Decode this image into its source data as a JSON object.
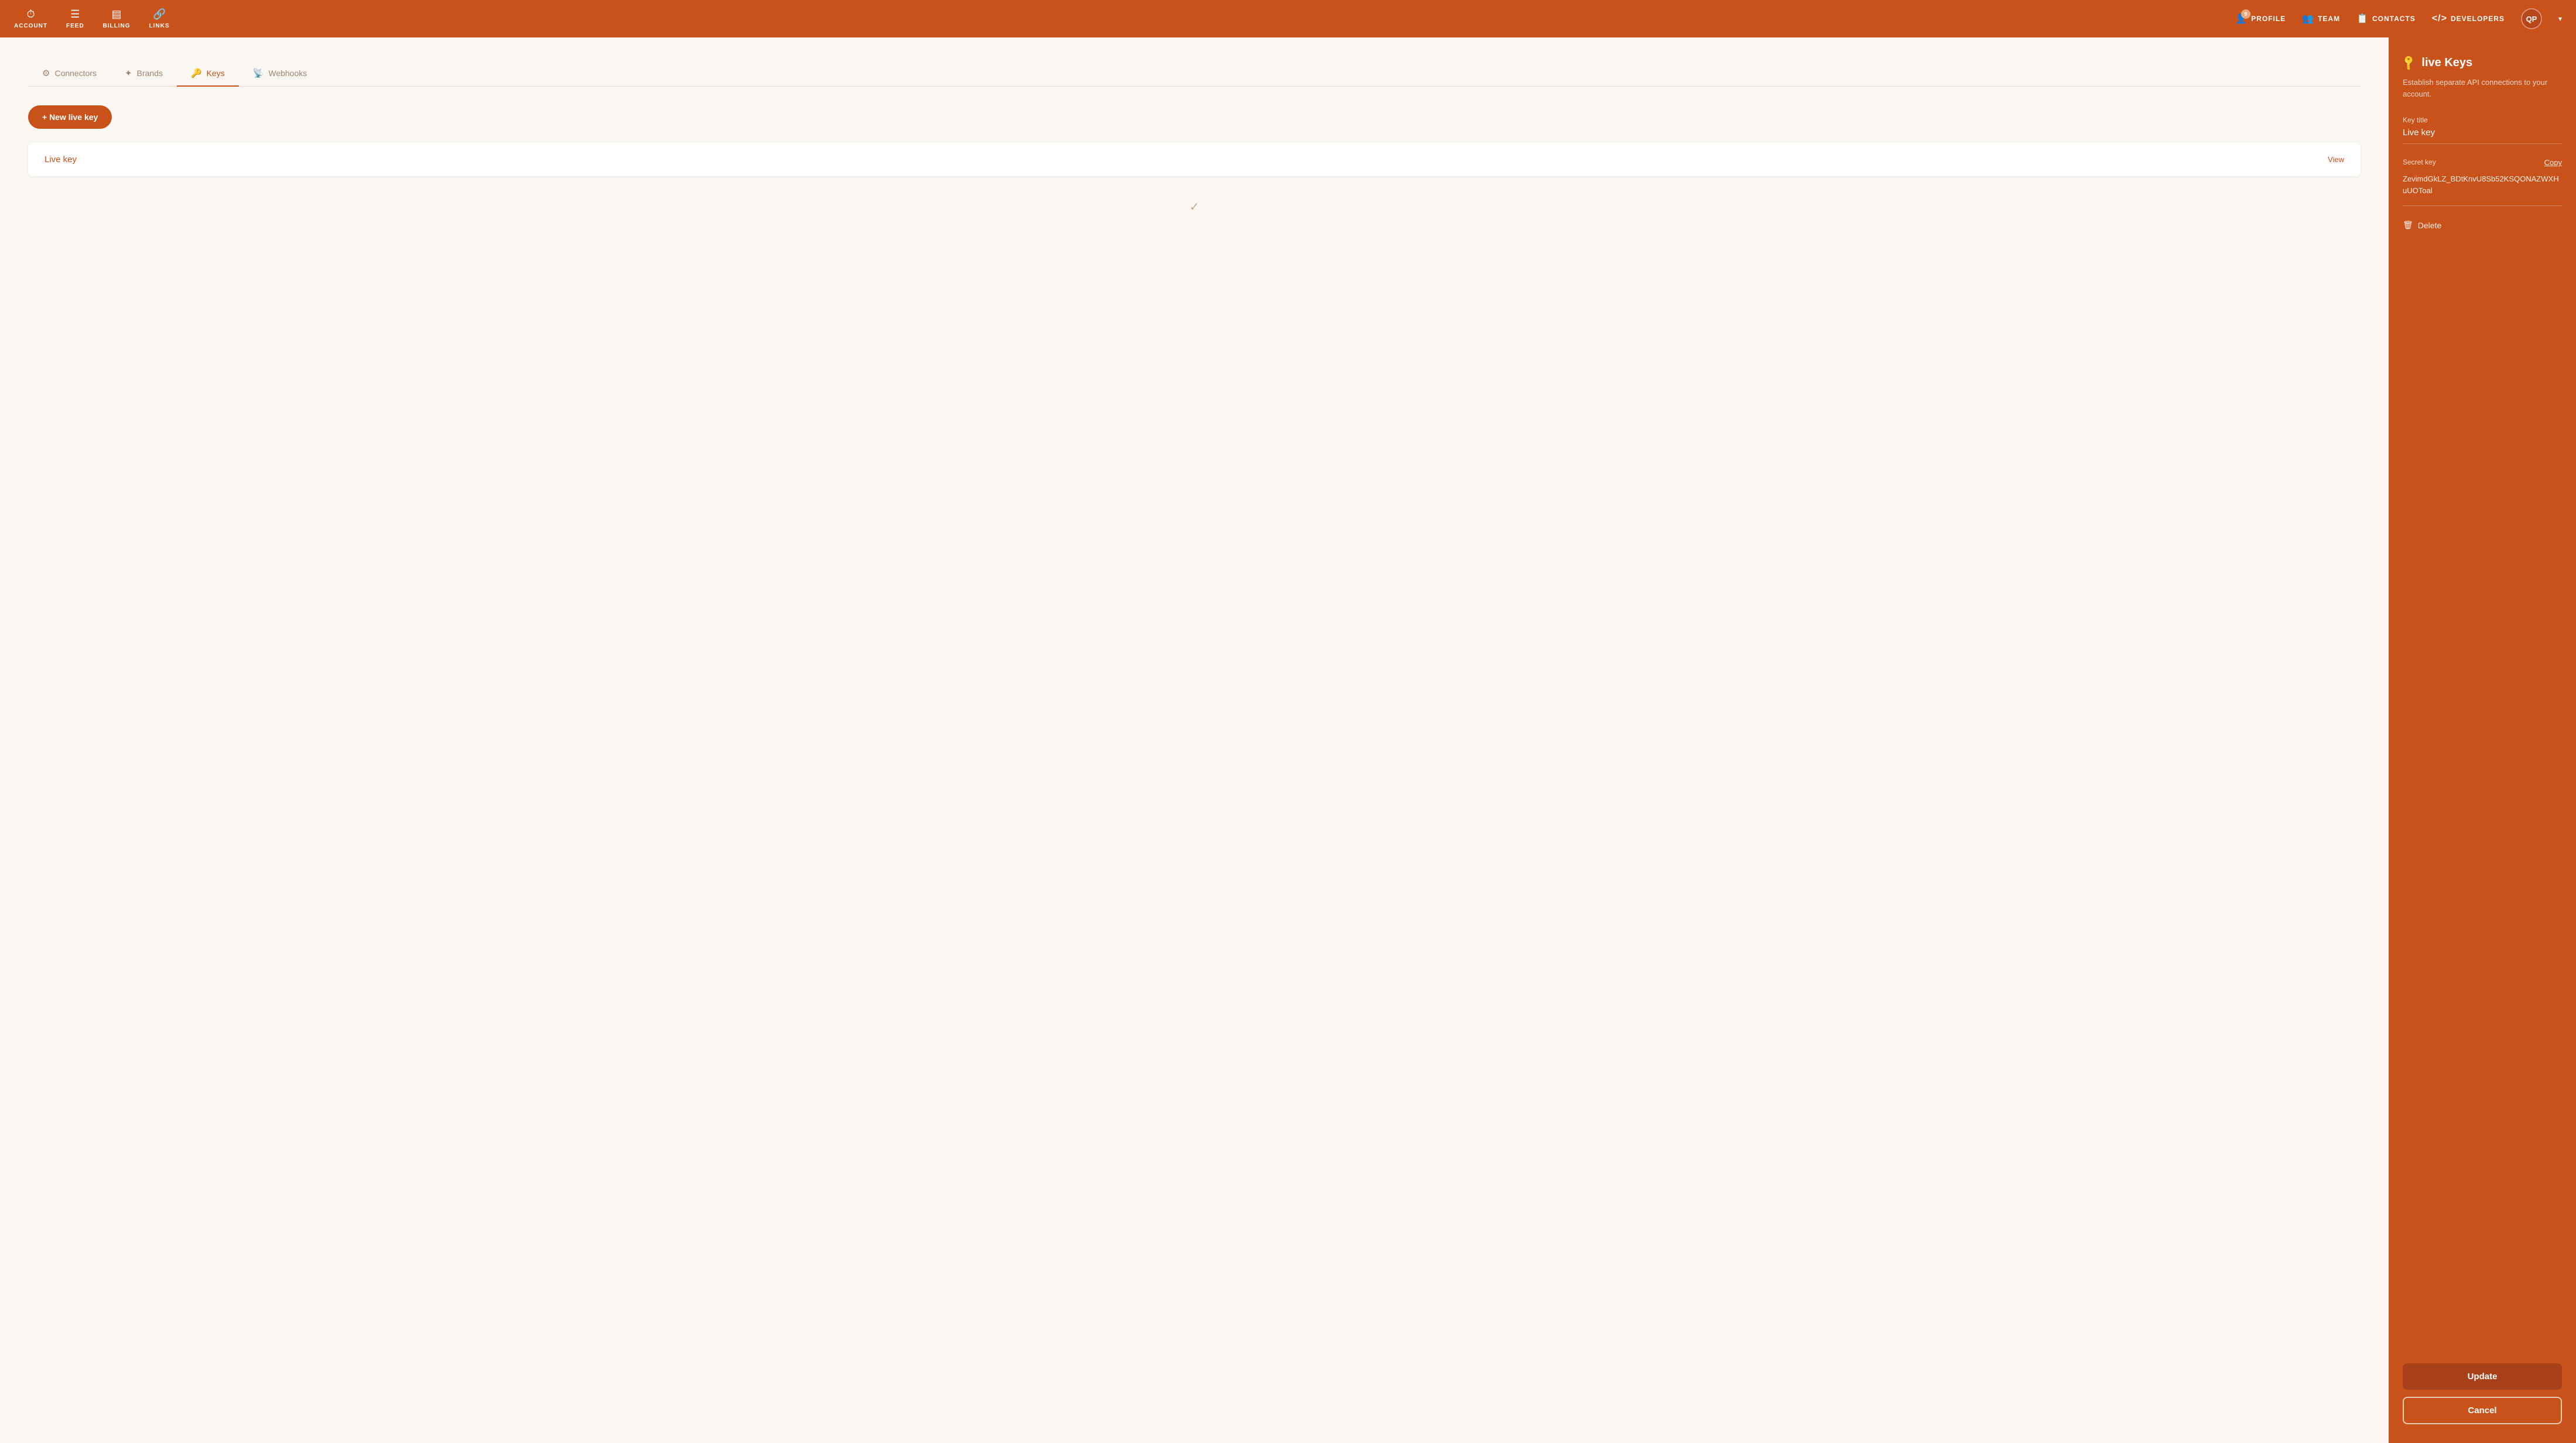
{
  "topnav": {
    "items": [
      {
        "id": "account",
        "label": "ACCOUNT",
        "icon": "⏱"
      },
      {
        "id": "feed",
        "label": "FEED",
        "icon": "≡"
      },
      {
        "id": "billing",
        "label": "BILLING",
        "icon": "▤"
      },
      {
        "id": "links",
        "label": "LINKS",
        "icon": "🔗"
      }
    ],
    "right_items": [
      {
        "id": "profile",
        "label": "PROFILE",
        "icon": "👤",
        "badge": "9"
      },
      {
        "id": "team",
        "label": "TEAM",
        "icon": "👥"
      },
      {
        "id": "contacts",
        "label": "CONTACTS",
        "icon": "📋"
      },
      {
        "id": "developers",
        "label": "DEVELOPERS",
        "icon": "</>"
      }
    ],
    "avatar_label": "QP"
  },
  "tabs": [
    {
      "id": "connectors",
      "label": "Connectors",
      "icon": "⚙"
    },
    {
      "id": "brands",
      "label": "Brands",
      "icon": "⭐"
    },
    {
      "id": "keys",
      "label": "Keys",
      "icon": "🔑",
      "active": true
    },
    {
      "id": "webhooks",
      "label": "Webhooks",
      "icon": "📡"
    }
  ],
  "new_key_button": "+ New live key",
  "key_item": {
    "name": "Live key",
    "view_label": "View"
  },
  "right_panel": {
    "title": "live Keys",
    "subtitle": "Establish separate API connections to your account.",
    "key_title_label": "Key title",
    "key_title_value": "Live key",
    "secret_key_label": "Secret key",
    "copy_label": "Copy",
    "secret_key_value": "ZevimdGkLZ_BDtKnvU8Sb52KSQONAZWXHuUOToal",
    "delete_label": "Delete",
    "update_label": "Update",
    "cancel_label": "Cancel"
  }
}
